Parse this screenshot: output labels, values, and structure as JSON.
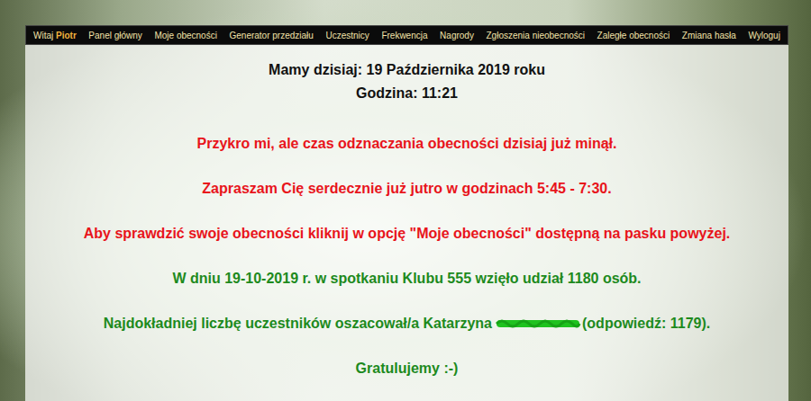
{
  "nav": {
    "greeting": "Witaj",
    "user": "Piotr",
    "items": [
      {
        "label": "Panel główny",
        "selected": false
      },
      {
        "label": "Moje obecności",
        "selected": false
      },
      {
        "label": "Generator przedziału",
        "selected": false
      },
      {
        "label": "Uczestnicy",
        "selected": false
      },
      {
        "label": "Frekwencja",
        "selected": false
      },
      {
        "label": "Nagrody",
        "selected": false
      },
      {
        "label": "Zgłoszenia nieobecności",
        "selected": false
      },
      {
        "label": "Zaległe obecności",
        "selected": false
      },
      {
        "label": "Zmiana hasła",
        "selected": false
      },
      {
        "label": "Wyloguj",
        "selected": false
      }
    ]
  },
  "header": {
    "date_line": "Mamy dzisiaj: 19 Października 2019 roku",
    "time_line": "Godzina: 11:21"
  },
  "notices": [
    "Przykro mi, ale czas odznaczania obecności dzisiaj już minął.",
    "Zapraszam Cię serdecznie już jutro w godzinach 5:45 - 7:30.",
    "Aby sprawdzić swoje obecności kliknij w opcję \"Moje obecności\" dostępną na pasku powyżej."
  ],
  "results": {
    "attendance": "W dniu 19-10-2019 r. w spotkaniu Klubu 555 wzięło udział 1180 osób.",
    "winner_prefix": "Najdokładniej liczbę uczestników oszacował/a Katarzyna",
    "winner_redacted": true,
    "winner_suffix": "(odpowiedź: 1179).",
    "congrats": "Gratulujemy :-)"
  }
}
